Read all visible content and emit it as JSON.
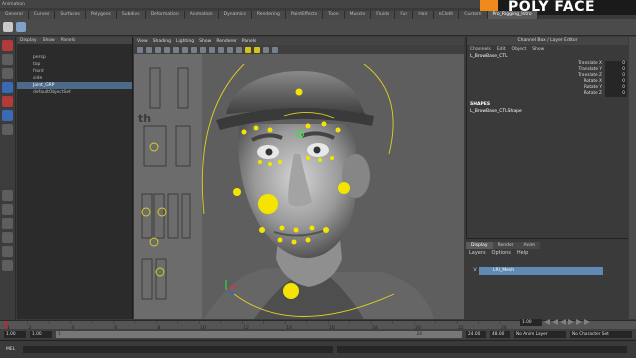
{
  "app": {
    "menubar_label": "Animation"
  },
  "logo": {
    "text": "POLY FACE",
    "accent": "#f08a1c"
  },
  "shelf_tabs": [
    {
      "label": "General",
      "active": false
    },
    {
      "label": "Curves",
      "active": false
    },
    {
      "label": "Surfaces",
      "active": false
    },
    {
      "label": "Polygons",
      "active": false
    },
    {
      "label": "Subdivs",
      "active": false
    },
    {
      "label": "Deformation",
      "active": false
    },
    {
      "label": "Animation",
      "active": false
    },
    {
      "label": "Dynamics",
      "active": false
    },
    {
      "label": "Rendering",
      "active": false
    },
    {
      "label": "PaintEffects",
      "active": false
    },
    {
      "label": "Toon",
      "active": false
    },
    {
      "label": "Muscle",
      "active": false
    },
    {
      "label": "Fluids",
      "active": false
    },
    {
      "label": "Fur",
      "active": false
    },
    {
      "label": "Hair",
      "active": false
    },
    {
      "label": "nCloth",
      "active": false
    },
    {
      "label": "Custom",
      "active": false
    },
    {
      "label": "Pro_Rigging_Intro",
      "active": true
    }
  ],
  "outliner": {
    "menu": [
      "Display",
      "Show",
      "Panels"
    ],
    "items": [
      {
        "label": "persp",
        "selected": false
      },
      {
        "label": "top",
        "selected": false
      },
      {
        "label": "front",
        "selected": false
      },
      {
        "label": "side",
        "selected": false
      },
      {
        "label": "Joint_GRP",
        "selected": true
      },
      {
        "label": "defaultObjectSet",
        "selected": false
      }
    ]
  },
  "viewport": {
    "menu": [
      "View",
      "Shading",
      "Lighting",
      "Show",
      "Renderer",
      "Panels"
    ],
    "panel_text": "th"
  },
  "channel_box": {
    "title": "Channel Box / Layer Editor",
    "menu": [
      "Channels",
      "Edit",
      "Object",
      "Show"
    ],
    "object_name": "L_BrowBase_CTL",
    "attributes": [
      {
        "name": "Translate X",
        "value": "0"
      },
      {
        "name": "Translate Y",
        "value": "0"
      },
      {
        "name": "Translate Z",
        "value": "0"
      },
      {
        "name": "Rotate X",
        "value": "0"
      },
      {
        "name": "Rotate Y",
        "value": "0"
      },
      {
        "name": "Rotate Z",
        "value": "0"
      }
    ],
    "shapes_label": "SHAPES",
    "shape_name": "L_BrowBase_CTLShape"
  },
  "layer_editor": {
    "tabs": [
      {
        "label": "Display",
        "active": true
      },
      {
        "label": "Render",
        "active": false
      },
      {
        "label": "Anim",
        "active": false
      }
    ],
    "menu": [
      "Layers",
      "Options",
      "Help"
    ],
    "layer": {
      "visibility": "V",
      "name": "LRI_Mesh"
    }
  },
  "timeline": {
    "current_frame": "1.00",
    "tick_labels": [
      "1",
      "2",
      "4",
      "6",
      "8",
      "10",
      "12",
      "14",
      "16",
      "18",
      "20",
      "22",
      "24"
    ]
  },
  "range_bar": {
    "start": "1.00",
    "inner_start": "1.00",
    "inner_value": "1",
    "range_end": "24",
    "end": "24.00",
    "max": "48.00",
    "anim_layer": "No Anim Layer",
    "character_set": "No Character Set"
  },
  "command_line": {
    "label": "MEL"
  },
  "colors": {
    "control_yellow": "#f5e400",
    "curve_yellow": "#e0d020",
    "selected_layer": "#5e8ab4"
  }
}
